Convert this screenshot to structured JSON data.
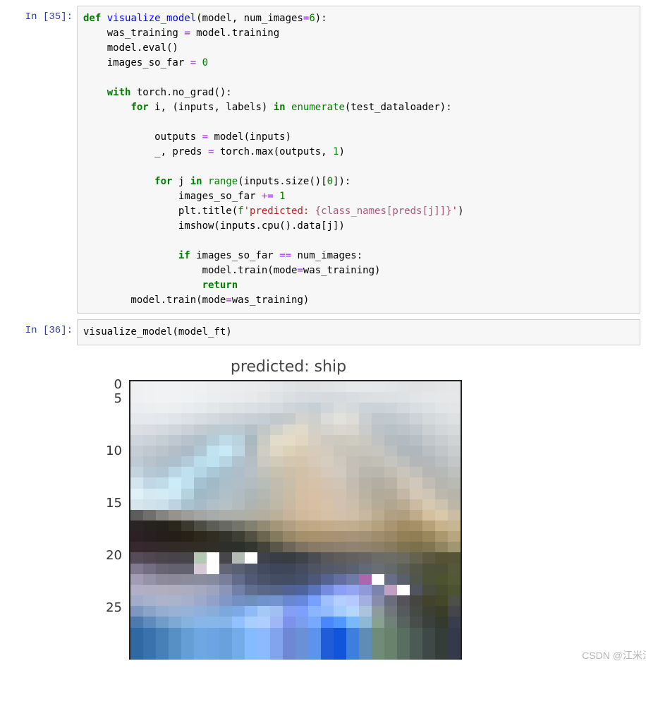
{
  "cells": [
    {
      "prompt": "In [35]:"
    },
    {
      "prompt": "In [36]:"
    }
  ],
  "code1": {
    "l1": {
      "def": "def",
      "name": "visualize_model",
      "p1": "(model, num_images",
      "eq": "=",
      "six": "6",
      "p2": "):"
    },
    "l2": "    was_training ",
    "l2b": "=",
    "l2c": " model.training",
    "l3": "    model.eval()",
    "l4a": "    images_so_far ",
    "l4b": "=",
    "l4c": " ",
    "l4d": "0",
    "l5": "",
    "l6a": "    ",
    "l6b": "with",
    "l6c": " torch.no_grad():",
    "l7a": "        ",
    "l7b": "for",
    "l7c": " i, (inputs, labels) ",
    "l7d": "in",
    "l7e": " ",
    "l7f": "enumerate",
    "l7g": "(test_dataloader):",
    "l8": "",
    "l9a": "            outputs ",
    "l9b": "=",
    "l9c": " model(inputs)",
    "l10a": "            _, preds ",
    "l10b": "=",
    "l10c": " torch.max(outputs, ",
    "l10d": "1",
    "l10e": ")",
    "l11": "",
    "l12a": "            ",
    "l12b": "for",
    "l12c": " j ",
    "l12d": "in",
    "l12e": " ",
    "l12f": "range",
    "l12g": "(inputs.size()[",
    "l12h": "0",
    "l12i": "]):",
    "l13a": "                images_so_far ",
    "l13b": "+=",
    "l13c": " ",
    "l13d": "1",
    "l14a": "                plt.title(",
    "l14b": "f",
    "l14c": "'predicted: ",
    "l14d": "{class_names[preds[j]]}",
    "l14e": "'",
    "l14f": ")",
    "l15": "                imshow(inputs.cpu().data[j])",
    "l16": "",
    "l17a": "                ",
    "l17b": "if",
    "l17c": " images_so_far ",
    "l17d": "==",
    "l17e": " num_images:",
    "l18a": "                    model.train(mode",
    "l18b": "=",
    "l18c": "was_training)",
    "l19a": "                    ",
    "l19b": "return",
    "l20a": "        model.train(mode",
    "l20b": "=",
    "l20c": "was_training)"
  },
  "code2": {
    "line": "visualize_model(model_ft)"
  },
  "chart_data": {
    "type": "heatmap",
    "title": "predicted: ship",
    "xlabel": "",
    "ylabel": "",
    "y_ticks": [
      0,
      5,
      10,
      15,
      20,
      25
    ],
    "xlim": [
      0,
      31
    ],
    "ylim": [
      0,
      31
    ],
    "note": "32x32 RGB image (CIFAR-like) rendered via imshow; values are pixel colors, not scalar data."
  },
  "watermark": "CSDN @江米江米",
  "image_rows": [
    "eef0f2 f0f1f3 f1f2f3 f1f2f3 f0f1f2 eef0f1 edeeef ecedee ebeced eaebec e8eaeb e5e7e8 e1e3e5 dfe1e3 dfe1e3 e1e3e5 e4e5e7 e6e8e9 e7e8ea e6e7e9 e3e5e7 e1e3e5 e0e2e4 e1e3e5 e3e5e7 e4e6e8",
    "eef0f2 f0f1f3 f1f2f3 f1f2f3 f0f1f2 eeeff1 ecedef eaecee e9ebec e7e9eb e4e6e8 e0e3e6 dbdfe2 d8dce0 d6dbdf d6dadf d7dbe0 d9dde1 dbdfe2 dce0e3 dde1e3 dfe2e4 e2e4e6 e5e6e8 e6e7e9 e5e7e8",
    "ebedf0 eceef0 edeff1 eceef0 eaedef e7eaed e3e7ea e0e4e7 dde2e5 dbe0e4 d8dde2 d4dade cfd5db cbd2d8 c7cfd6 d0d5d9 d8dcdd d5d9db cdd4d9 cbd3d9 ced5da d3d9dd d9dee0 dee1e3 e2e4e5 e3e5e6",
    "e5e8ec e5e8ec e4e7eb e1e5e9 dde1e6 d8dde2 d3d9de cfd5db cbd2d9 c8d0d7 c5cdd5 c1c8ce c7caca d4d3cd ced0ce dbdcd9 e3e1dc dddcd9 cacfd2 bfc8ce c0c9cf c5cdd2 cdd3d7 d4d9db dadddf dee0e1",
    "dbdfe4 d9dde2 d5dae0 d0d6dc cad1d8 c3ccd3 becad1 bdcbd2 bbc9d1 b5c1c8 c2c7c7 d0d1c9 ded9cd e1dacb d2d0c9 d5d3cd dbd7cf d8d5ce c9ccca bcc4c8 b7c1c8 bbc4ca c2c9ce cbd0d3 d2d6d7 d7dadb",
    "cfd5dc cbd2d9 c6ced5 bfc8d1 b8c2cc b1c1cc b5cdd9 c0dbe8 bbd3df aab8bf cbcbc5 e1dbcb e5dcc8 e0d6c2 d6cfc2 cecac1 cccabf cecbc1 c9c9c2 c0c3c2 b4bcc0 b2bbc1 b8c0c5 c1c7cb c9cdcf d0d3d4",
    "c5cdd5 c0c9d2 bac4cd b3bec8 adbbc8 b0c7d5 c2e2f1 c9e9f6 bfd7e3 b0bac0 d0cdc4 dfd7c4 dcd2ba d8ccb5 d7ccbb d3cbbe cbc6ba c7c4b9 c7c4bb c6c5bf bcc0bf b1b8bb b1b8bd b9bfc2 c2c6c8 cacdce",
    "becbd4 b7c4ce b0bfca aec0cd b2cad9 bbdceb bfe2f1 b7d5e3 b0c3cf b5bec4 cbc9c1 d2cbb9 d3c7af d4c6ae d6c9b7 d6ccc0 cfc8bf c4c0b7 bfbdb4 c1bfb6 c5c4be bdbfbd b3b7b8 b4b8ba bbbfc0 c4c6c7",
    "c3d4de b5c8d4 b0c6d3 bad6e5 bee0ef b4d6e6 abc8d7 a9c0cd adbec9 b7c0c6 c1c2bc c7c1b2 ccc0ab d2c1a9 d5c4b0 d6c9bb d3cabf c5bfb6 bab7ac b9b6ab c1bdb2 cac5bc c2c0ba b6b7b4 b7b9b7 bec0be",
    "d3e6ef c1d8e4 c1dce9 cdecf9 bfe0ef a5c2d2 a2bac8 abbfca afbec7 b3bdc1 b9bdb8 c0bcaf c9bea9 d3c0a7 d6c1a9 d4c3b1 d1c5b7 c4bcb0 b7b2a5 b3aea1 bab3a5 cbc1b3 d1c8bd c1bdb4 b7b5af babab4",
    "e0f1f8 d5e9f2 d3ebf5 cde9f5 b5d2df a0b9c7 a6bbc6 b0c0c9 b0bcc2 aeb7b8 b4b7b2 bfbaac c9bca6 d4bfa5 d7c0a5 d4c0ab d1c2b0 c7bcad bab2a3 b2ab9b b4ab9a c4b7a5 d4c7b5 cec5b6 bdb8ac b7b5ab",
    "d7e6ec d1e2ea cce0ea bdd4e0 abc2cf a7bbc6 b0bfc8 b6c1c6 b3bbbd afb4b2 b4b4ab bfb8a7 cab9a2 d4bda0 d8bfa1 d6c1a9 d2c1ae cbbeab c0b5a1 b5ab96 b1a68f baac93 ccbba2 d7c8b1 cdc2af bcb6a6",
    "5e5d5b 706f6b 86847e 95938b 9e9e98 a3a6a3 a7aba9 abaeab aeafa9 b0afa4 b4ae9e bdb09a c7b49a d0b99c d5bd9f d6c0a6 d3c0ab cfbfa9 c7b89f bcac90 b1a083 b19e7f c0ab8a d4bf9e dac8aa cabda3",
    "2a2424 262220 24211b 2b271d 3b382d 4d4d43 5c5e56 686a61 74746a 82806f 928a73 a39679 b29e80 bca684 c2a986 c4ac8b c3ae8f c2ae8f bda988 b5a17c aa9570 a28c64 a69067 b7a178 c8b28b c8b693",
    "2c2024 281f21 251e1b 241e16 272116 2c281c 302e22 33332a 3d3e34 515041 6c6650 857a5e 988867 a4906c a8926d a89271 a89275 a79379 a49275 a08d6d 9a8764 938058 917e54 9a875c ab986e b8a680",
    "372830 34282c 32292a 312a27 312c25 312d25 302e27 2e2f2a 2d2f2b 333530 434339 59564a 6e6759 7f7463 887a67 8b7d6a 8e806e 908371 8f836e 8c8068 867b5e 7e7451 7a704a 807651 8f8561 a0966f",
    "564c59 4f4752 4a444b 48434a 47444a 4746 4a 47474b 4546 4b 3f424a 393d46 383d44 3f4249 4c4d52 585759 5f5d5b 636060 666565 6b6b6a 6d6d67 6a6a5e 646350 5b5941 555335 565436 636142 777551",
    "817a8f 736e81 686474 63616f 626170 6364 73 616576 5a6073 4e566a 424b60 3d465a 3e465a 454c5f 4e5464 545968 565c6c 5a6272 636a77 686e73 64696a 5c6059 545747 4e513a 4d5036 555839 646847",
    "a29db5 9692a7 8d8a9c 8a8899 8b8b9b 8b8d9e 868ba0 797f9a 636b8a 505a77 485269 444e63 424c62 444f68 4b587a 556390 616fa1 6d7ba5 7079 9a 676f86 595f6b 50564c 4c5237 4d5330 535934 5e6245",
    "b1afc8 b0aec3 b0aebf aeadbe abacbf a6aac0 9da4bf 8b95b8 7280a9 5f708f 586886 556588 516294 4e64a0 5a73bd 758be0 8ba0f4 94a6f0 8e9bd7 7b84ab 6166 84 51545e 484c3d 484c2f 4d522f 555952",
    "a1acca a8b1cc acb3cb abb3cb a6afcb 9ca9cb 91a2ca 8197c8 7291c2 6e90bf 7193cb 7494d1 6988d2 6688de 78a0ff 9ec0ff b4ceff b6c9ff a3afdf 878da8 6b6c7c 555359 47463e 42422d 454729 4d5049",
    "7c98c0 89a4c8 95adce 99b1d3 97b2d7 90afda 87add8 7ca8dc 7caae6 8fbaf5 a4c9f5 a1c0f1 869ef4 7ea0fc 8bb5ff 93bcff a6cdff b4d6ff abc3dc 8e9a9e 70767b 575a5d 474945 3d3f32 3b3e26 44464a",
    "4d7aae 5e8bbb 709cc8 7ea9d4 86b2de 88b6ea 86b7e8 85b5ea 93c0ff a7ceff afceff 9fb7f7 7e92eb 7a9fef 77aaff 4a86ff 5197ff 78b8ff 8eb9d6 89a290 70807b 58625f 494e4d 3c403c 363a2d 3a3d4c",
    "3068a5 3972ad 4680b7 5690c5 659ed4 6ea7e2 6da4e4 68a1de 74ace9 85bbff 8cb9ff 82a4ee 6e88d6 6a91d8 5b93ef 205bd8 1155db 3c7fdd 5f8cb7 6e8c78 68826b 586e60 4b5a55 3e4947 353d38 343a4a"
  ]
}
